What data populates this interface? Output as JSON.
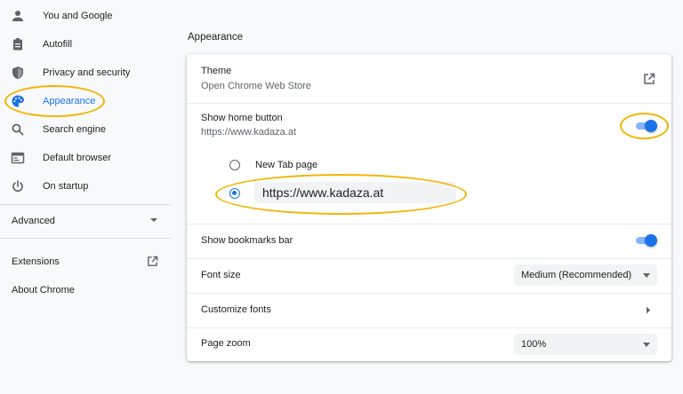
{
  "sidebar": {
    "items": [
      {
        "label": "You and Google",
        "icon": "person-icon"
      },
      {
        "label": "Autofill",
        "icon": "clipboard-icon"
      },
      {
        "label": "Privacy and security",
        "icon": "shield-icon"
      },
      {
        "label": "Appearance",
        "icon": "palette-icon",
        "active": true
      },
      {
        "label": "Search engine",
        "icon": "search-icon"
      },
      {
        "label": "Default browser",
        "icon": "browser-icon"
      },
      {
        "label": "On startup",
        "icon": "power-icon"
      }
    ],
    "advanced_label": "Advanced",
    "extensions_label": "Extensions",
    "about_label": "About Chrome"
  },
  "main": {
    "section_title": "Appearance",
    "theme": {
      "label": "Theme",
      "sublabel": "Open Chrome Web Store"
    },
    "home_button": {
      "label": "Show home button",
      "sublabel": "https://www.kadaza.at",
      "enabled": true,
      "options": {
        "new_tab_label": "New Tab page",
        "custom_url_value": "https://www.kadaza.at"
      },
      "selected_option": "custom_url"
    },
    "bookmarks_bar": {
      "label": "Show bookmarks bar",
      "enabled": true
    },
    "font_size": {
      "label": "Font size",
      "value": "Medium (Recommended)"
    },
    "customize_fonts": {
      "label": "Customize fonts"
    },
    "page_zoom": {
      "label": "Page zoom",
      "value": "100%"
    }
  },
  "colors": {
    "accent": "#1a73e8",
    "highlight": "#f4b400"
  }
}
